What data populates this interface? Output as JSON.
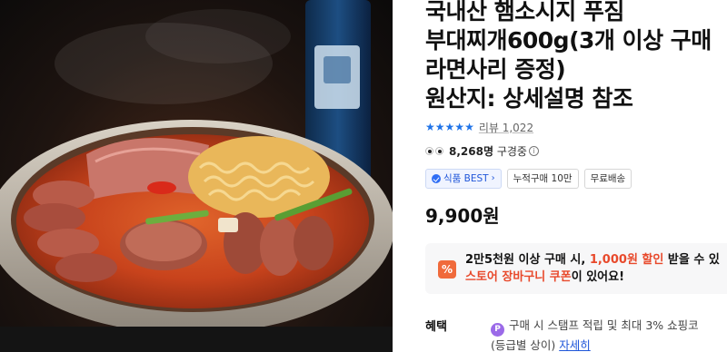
{
  "product": {
    "title_lines": [
      "국내산 햄소시지 푸짐",
      "부대찌개600g(3개 이상 구매",
      "라면사리 증정)",
      "원산지: 상세설명 참조"
    ],
    "rating_stars": 4.5,
    "review_label": "리뷰 1,022",
    "viewing_count": "8,268명",
    "viewing_text": "구경중",
    "info_icon_glyph": "i",
    "badges": [
      {
        "icon": "check-badge-icon",
        "label": "식품 BEST",
        "chevron": "›"
      },
      {
        "label": "누적구매 10만"
      },
      {
        "label": "무료배송"
      }
    ],
    "price": "9,900원"
  },
  "coupon": {
    "icon_glyph": "%",
    "line1_prefix": "2만5천원 이상 구매 시, ",
    "line1_amount": "1,000원 할인",
    "line1_suffix": " 받을 수 있",
    "line2_highlight": "스토어 장바구니 쿠폰",
    "line2_suffix": "이 있어요!"
  },
  "benefit": {
    "label": "혜택",
    "icon_glyph": "P",
    "line1": "구매 시 스탬프 적립 및 최대 3% 쇼핑코",
    "line2_prefix": "(등급별 상이) ",
    "line2_link": "자세히"
  },
  "colors": {
    "accent_blue": "#1f73e8",
    "coupon_orange": "#e8492b",
    "point_purple": "#9b6ae8"
  }
}
